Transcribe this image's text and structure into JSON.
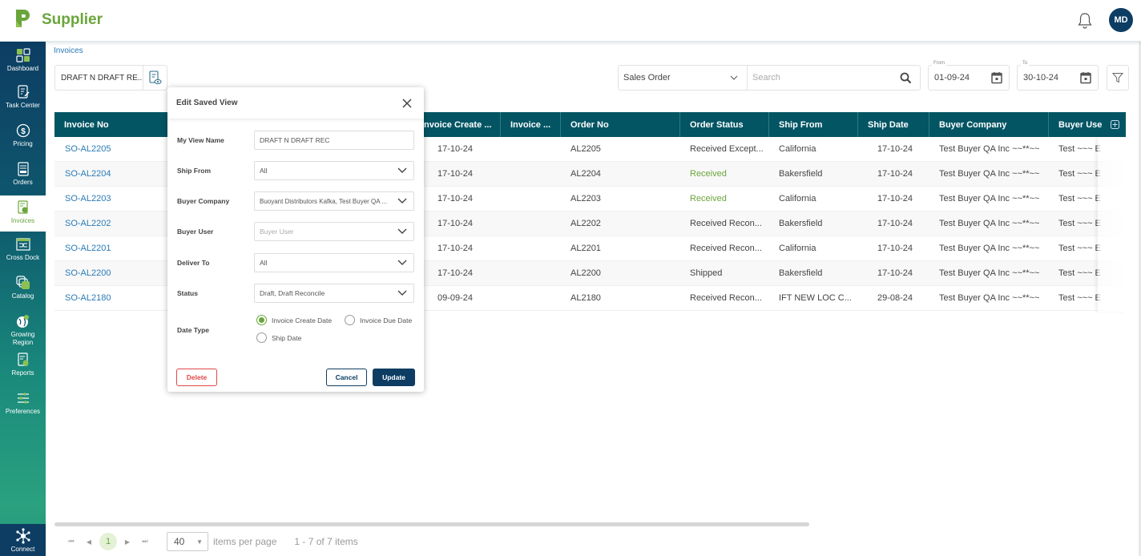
{
  "header": {
    "app_title": "Supplier",
    "logo_icon": "p-logo-icon",
    "bell_icon": "bell-icon",
    "avatar_initials": "MD"
  },
  "sidebar": {
    "items": [
      {
        "label": "Dashboard",
        "icon": "dashboard-icon",
        "active": false
      },
      {
        "label": "Task Center",
        "icon": "task-center-icon",
        "active": false
      },
      {
        "label": "Pricing",
        "icon": "dollar-icon",
        "active": false
      },
      {
        "label": "Orders",
        "icon": "orders-icon",
        "active": false
      },
      {
        "label": "Invoices",
        "icon": "invoice-icon",
        "active": true
      },
      {
        "label": "Cross Dock",
        "icon": "cross-dock-icon",
        "active": false
      },
      {
        "label": "Catalog",
        "icon": "catalog-icon",
        "active": false
      },
      {
        "label": "Growing Region",
        "icon": "globe-pin-icon",
        "active": false
      },
      {
        "label": "Reports",
        "icon": "reports-icon",
        "active": false
      },
      {
        "label": "Preferences",
        "icon": "sliders-icon",
        "active": false
      }
    ],
    "connect_label": "Connect"
  },
  "breadcrumb": "Invoices",
  "saved_view": {
    "value": "DRAFT N DRAFT RE..."
  },
  "toolbar": {
    "type_select": "Sales Order",
    "search_placeholder": "Search",
    "from_label": "From",
    "from_date": "01-09-24",
    "to_label": "To",
    "to_date": "30-10-24"
  },
  "grid": {
    "columns": [
      "Invoice No",
      "Invoice Create ...",
      "Invoice ...",
      "Order No",
      "Order Status",
      "Ship From",
      "Ship Date",
      "Buyer Company",
      "Buyer Use"
    ],
    "rows": [
      {
        "invoice_no": "SO-AL2205",
        "create_date": "17-10-24",
        "invoice_due": "",
        "order_no": "AL2205",
        "order_status": "Received Except...",
        "status_green": false,
        "ship_from": "California",
        "ship_date": "17-10-24",
        "buyer_company": "Test Buyer QA Inc ~~**~~",
        "buyer_user": "Test ~~~ E"
      },
      {
        "invoice_no": "SO-AL2204",
        "create_date": "17-10-24",
        "invoice_due": "",
        "order_no": "AL2204",
        "order_status": "Received",
        "status_green": true,
        "ship_from": "Bakersfield",
        "ship_date": "17-10-24",
        "buyer_company": "Test Buyer QA Inc ~~**~~",
        "buyer_user": "Test ~~~ E"
      },
      {
        "invoice_no": "SO-AL2203",
        "create_date": "17-10-24",
        "invoice_due": "",
        "order_no": "AL2203",
        "order_status": "Received",
        "status_green": true,
        "ship_from": "California",
        "ship_date": "17-10-24",
        "buyer_company": "Test Buyer QA Inc ~~**~~",
        "buyer_user": "Test ~~~ E"
      },
      {
        "invoice_no": "SO-AL2202",
        "create_date": "17-10-24",
        "invoice_due": "",
        "order_no": "AL2202",
        "order_status": "Received Recon...",
        "status_green": false,
        "ship_from": "Bakersfield",
        "ship_date": "17-10-24",
        "buyer_company": "Test Buyer QA Inc ~~**~~",
        "buyer_user": "Test ~~~ E"
      },
      {
        "invoice_no": "SO-AL2201",
        "create_date": "17-10-24",
        "invoice_due": "",
        "order_no": "AL2201",
        "order_status": "Received Recon...",
        "status_green": false,
        "ship_from": "California",
        "ship_date": "17-10-24",
        "buyer_company": "Test Buyer QA Inc ~~**~~",
        "buyer_user": "Test ~~~ E"
      },
      {
        "invoice_no": "SO-AL2200",
        "create_date": "17-10-24",
        "invoice_due": "",
        "order_no": "AL2200",
        "order_status": "Shipped",
        "status_green": false,
        "ship_from": "Bakersfield",
        "ship_date": "17-10-24",
        "buyer_company": "Test Buyer QA Inc ~~**~~",
        "buyer_user": "Test ~~~ E"
      },
      {
        "invoice_no": "SO-AL2180",
        "create_date": "09-09-24",
        "invoice_due": "",
        "order_no": "AL2180",
        "order_status": "Received Recon...",
        "status_green": false,
        "ship_from": "IFT NEW LOC C...",
        "ship_date": "29-08-24",
        "buyer_company": "Test Buyer QA Inc ~~**~~",
        "buyer_user": "Test ~~~ E"
      }
    ]
  },
  "pager": {
    "page": "1",
    "page_size": "40",
    "items_per_page_label": "items per page",
    "summary": "1 - 7 of 7 items"
  },
  "modal": {
    "title": "Edit Saved View",
    "fields": {
      "view_name_label": "My View Name",
      "view_name_value": "DRAFT N DRAFT REC",
      "ship_from_label": "Ship From",
      "ship_from_value": "All",
      "buyer_company_label": "Buyer Company",
      "buyer_company_value": "Buoyant Distributors Kafka, Test Buyer QA ...",
      "buyer_user_label": "Buyer User",
      "buyer_user_placeholder": "Buyer User",
      "deliver_to_label": "Deliver To",
      "deliver_to_value": "All",
      "status_label": "Status",
      "status_value": "Draft, Draft Reconcile",
      "date_type_label": "Date Type"
    },
    "date_type_options": [
      {
        "label": "Invoice Create Date",
        "selected": true
      },
      {
        "label": "Invoice Due Date",
        "selected": false
      },
      {
        "label": "Ship Date",
        "selected": false
      }
    ],
    "delete_label": "Delete",
    "cancel_label": "Cancel",
    "update_label": "Update"
  },
  "colors": {
    "brand_green": "#6aa53b",
    "navy": "#0d3d63",
    "header_teal": "#045564",
    "link_blue": "#2a7ab6",
    "delete_red": "#e04848"
  }
}
